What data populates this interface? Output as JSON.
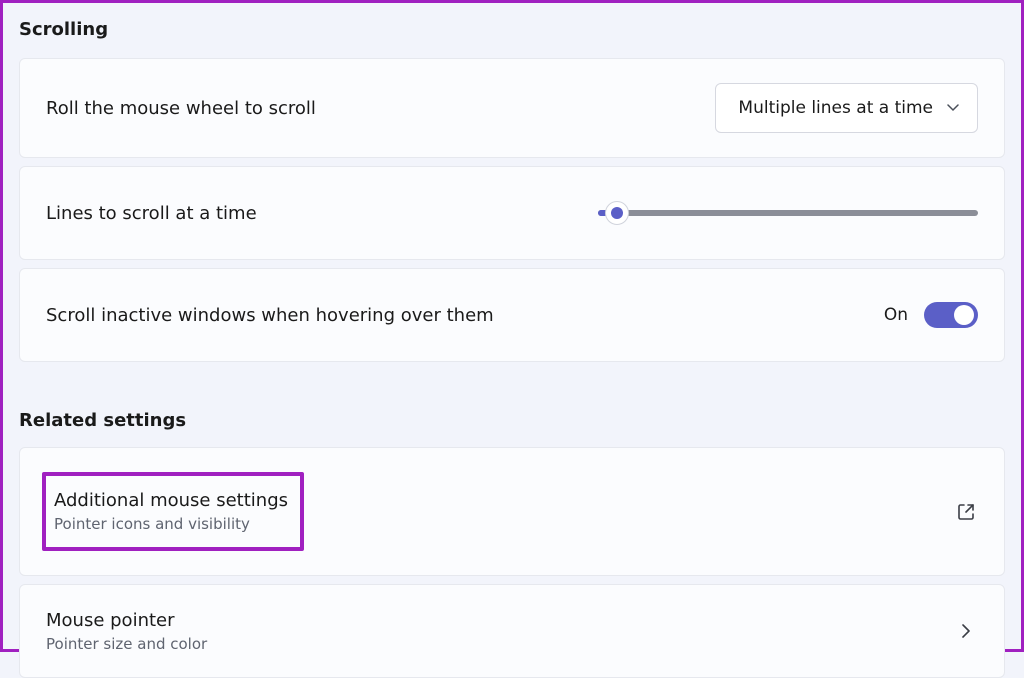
{
  "sections": {
    "scrolling": {
      "title": "Scrolling",
      "roll_wheel": {
        "label": "Roll the mouse wheel to scroll",
        "dropdown_value": "Multiple lines at a time"
      },
      "lines_scroll": {
        "label": "Lines to scroll at a time",
        "slider_percent": 5
      },
      "inactive_windows": {
        "label": "Scroll inactive windows when hovering over them",
        "state_text": "On",
        "state": true
      }
    },
    "related": {
      "title": "Related settings",
      "additional": {
        "title": "Additional mouse settings",
        "subtitle": "Pointer icons and visibility"
      },
      "pointer": {
        "title": "Mouse pointer",
        "subtitle": "Pointer size and color"
      }
    }
  },
  "colors": {
    "accent": "#5b5fc7",
    "highlight": "#a020c0"
  }
}
